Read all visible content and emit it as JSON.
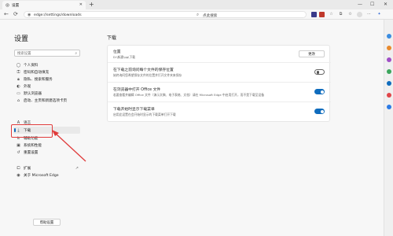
{
  "tab": {
    "title": "设置",
    "close": "✕"
  },
  "window": {
    "new_tab": "+",
    "minimize": "—",
    "maximize": "☐",
    "close": "✕"
  },
  "address_bar": {
    "url": "edge://settings/downloads",
    "search_label": "点此搜索"
  },
  "settings": {
    "title": "设置",
    "search_placeholder": "搜索设置"
  },
  "sidebar": {
    "items": [
      {
        "label": "个人资料",
        "icon": "person-icon"
      },
      {
        "label": "密码和自动填充",
        "icon": "key-icon"
      },
      {
        "label": "隐私、搜索和服务",
        "icon": "lock-icon"
      },
      {
        "label": "外观",
        "icon": "appearance-icon"
      },
      {
        "label": "默认浏览器",
        "icon": "browser-icon"
      },
      {
        "label": "启动、主页和新建选项卡页",
        "icon": "home-icon"
      },
      {
        "label": "语言",
        "icon": "language-icon"
      },
      {
        "label": "下载",
        "icon": "download-icon",
        "active": true
      },
      {
        "label": "辅助功能",
        "icon": "accessibility-icon"
      },
      {
        "label": "系统和性能",
        "icon": "system-icon"
      },
      {
        "label": "重置设置",
        "icon": "reset-icon"
      },
      {
        "label": "扩展",
        "icon": "extensions-icon"
      },
      {
        "label": "关于 Microsoft Edge",
        "icon": "edge-icon"
      }
    ],
    "default_button": "帮助设置"
  },
  "downloads": {
    "title": "下载",
    "location": {
      "title": "位置",
      "value": "D:\\新建\\qq\\下载",
      "button": "更改"
    },
    "ask_where": {
      "title": "在下载之前询问每个文件的保存位置",
      "desc": "始终询问您希望保存文件的位置并打开文件夹来保存",
      "enabled": false
    },
    "office_open": {
      "title": "在浏览器中打开 Office 文件",
      "desc": "若要查看并编辑 Office 文件（演示文稿、电子表格、文档）请在 Microsoft Edge 中启用打开，而不是下载至设备",
      "enabled": true
    },
    "show_menu": {
      "title": "下载开始时显示下载菜单",
      "desc": "启用此设置在会开始时显示的下载菜单打开下载",
      "enabled": true
    }
  },
  "colors": {
    "accent": "#0f6cbd",
    "highlight": "#e03b3b"
  }
}
